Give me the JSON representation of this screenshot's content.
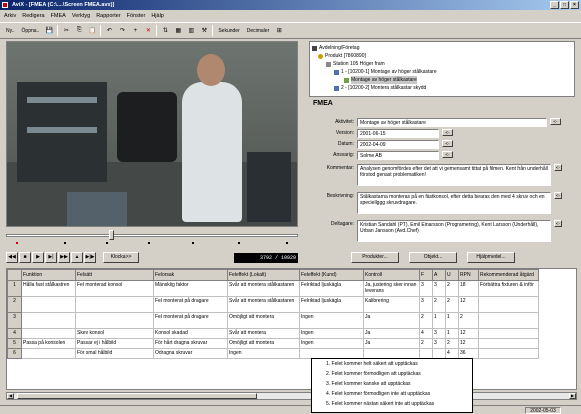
{
  "window": {
    "title": "AviX - [FMEA (C:\\....\\Screen FMEA.avx)]",
    "min": "_",
    "max": "□",
    "close": "×"
  },
  "menu": [
    "Arkiv",
    "Redigera",
    "FMEA",
    "Verktyg",
    "Rapporter",
    "Fönster",
    "Hjälp"
  ],
  "toolbar": {
    "ny": "Ny..",
    "oppna": "Öppna..",
    "sv": "Sv",
    "enhet": "Sekunder",
    "decimaler": "Decimaler"
  },
  "player": {
    "timecode": "3792 / 10929",
    "klocka": "Klocka>>",
    "buttons": [
      "◀◀",
      "■",
      "▶",
      "▶|",
      "▶▶",
      "▲",
      "▶|▶"
    ]
  },
  "tree": [
    {
      "label": "Avdelning/Företag",
      "level": 0
    },
    {
      "label": "Produkt        [7860890]",
      "level": 1
    },
    {
      "label": "Station 105 Höger fram",
      "level": 2
    },
    {
      "label": "1 - [10200-1]    Montage av höger stålkastare",
      "level": 3
    },
    {
      "label": "Montage av höger stålkastare",
      "level": 4,
      "selected": true
    },
    {
      "label": "2 - [10200-2]    Montera stålkastar skydd",
      "level": 3
    }
  ],
  "fmea": {
    "title": "FMEA",
    "aktivitet_label": "Aktivitet:",
    "aktivitet": "Montage av höger stålkastare",
    "version_label": "Version:",
    "version": "2001-06-15",
    "datum_label": "Datum:",
    "datum": "2002-04-09",
    "ansvarig_label": "Ansvarig:",
    "ansvarig": "Solme AB",
    "kommentar_label": "Kommentar:",
    "kommentar": "Analysen genomfördes efter det att vi gemensamt tittat på filmen. Kent från underhåll förstod genast problematiken!",
    "beskrivning_label": "Beskrivning:",
    "beskrivning": "Stålkastarna monteras på en fästkonsol, efter detta bearas den med 4 skruv och en speciellggg skruvdragare.",
    "deltagare_label": "Deltagare:",
    "deltagare": "Kristian Sandahl (PT), Emil Einarsson (Programering), Kent Larsson (Underhåll), Urban Jansson (Avd.Chef)",
    "btn_label": "<-",
    "produkter": "Produkter...",
    "objekt": "Objekt...",
    "hjalpmedel": "Hjälpmedel..."
  },
  "grid": {
    "headers": [
      "Funktion",
      "Felsätt",
      "Felorsak",
      "Feleffekt (Lokalt)",
      "Feleffekt (Kund)",
      "Kontroll",
      "F",
      "A",
      "U",
      "RPN",
      "Rekommenderad åtgärd"
    ],
    "rows": [
      [
        "1",
        "Hålla fast stålkastren",
        "Fel monterad konsol",
        "Mänsklig faktor",
        "Svår att montera stålkastaren",
        "Felriktad ljuskägla",
        "Ja, justering sker innan leverans",
        "3",
        "3",
        "2",
        "18",
        "Förbättra fixturen & inför"
      ],
      [
        "2",
        "",
        "",
        "Fel monterat på dragare",
        "Svår att montera stålkastaren",
        "Felriktad ljuskägla",
        "Kalibrering",
        "3",
        "2",
        "2",
        "12",
        ""
      ],
      [
        "3",
        "",
        "",
        "Fel monterat på dragare",
        "Omöjligt att montera",
        "Ingen",
        "Ja",
        "2",
        "1",
        "1",
        "2",
        ""
      ],
      [
        "4",
        "",
        "Skev konsol",
        "Konsol skadad",
        "Svår att montera",
        "Ingen",
        "Ja",
        "4",
        "3",
        "1",
        "12",
        ""
      ],
      [
        "5",
        "Passa på konsolen",
        "Passar ej i hålbild",
        "För hårt dragna skruvar",
        "Omöjligt att montera",
        "Ingen",
        "Ja",
        "2",
        "3",
        "2",
        "12",
        ""
      ],
      [
        "6",
        "",
        "För smal hålbild",
        "Odragna skruvar",
        "Ingen",
        "",
        "",
        "",
        "",
        "4",
        "36",
        ""
      ]
    ]
  },
  "dropdown": [
    "1. Felet kommer helt säkert att upptäckas",
    "2. Felet kommer förmodligen att upptäckas",
    "3. Felet kommer kanske att upptäckas",
    "4. Felet kommer förmodligen inte att upptäckas",
    "5. Felet kommer nästan säkert inte att upptäckas"
  ],
  "status": {
    "date": "2002-05-03"
  }
}
